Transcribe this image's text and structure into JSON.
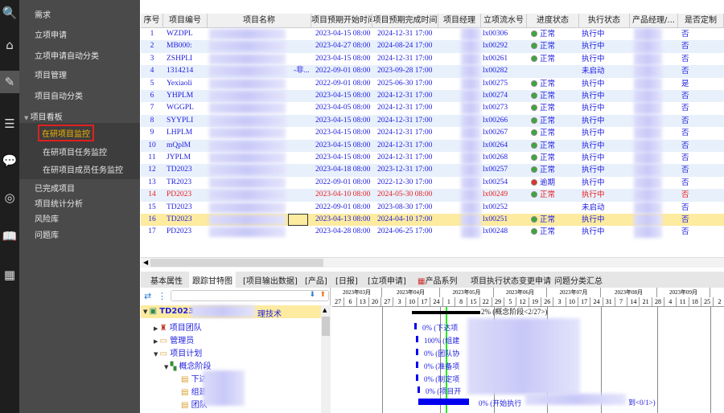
{
  "sidebar": {
    "items": [
      "需求",
      "立项申请",
      "立项申请自动分类",
      "项目管理",
      "项目自动分类",
      "项目看板",
      "在研项目监控",
      "在研项目任务监控",
      "在研项目成员任务监控",
      "已完成项目",
      "项目统计分析",
      "风险库",
      "问题库"
    ]
  },
  "table": {
    "headers": [
      "序号",
      "项目编号",
      "项目名称",
      "项目预期开始时间",
      "项目预期完成时间",
      "项目经理",
      "立项流水号",
      "进度状态",
      "执行状态",
      "产品经理/...",
      "是否定制"
    ],
    "rows": [
      [
        "1",
        "WZDPL",
        "2023-04-15 08:00",
        "2024-12-31 17:00",
        "lx00306",
        "正常",
        "执行中",
        "否"
      ],
      [
        "2",
        "MB000:",
        "2023-04-27 08:00",
        "2024-08-24 17:00",
        "lx00292",
        "正常",
        "执行中",
        "否"
      ],
      [
        "3",
        "ZSHPLI",
        "2023-04-15 08:00",
        "2024-12-31 17:00",
        "lx00261",
        "正常",
        "执行中",
        "否"
      ],
      [
        "4",
        "1314214",
        "2022-09-01 08:00",
        "2023-09-28 17:00",
        "lx00282",
        "",
        "未启动",
        "否"
      ],
      [
        "5",
        "Yexiaoli",
        "2022-09-01 08:00",
        "2025-06-30 17:00",
        "lx00275",
        "正常",
        "执行中",
        "是"
      ],
      [
        "6",
        "YHPLM",
        "2023-04-15 08:00",
        "2024-12-31 17:00",
        "lx00274",
        "正常",
        "执行中",
        "否"
      ],
      [
        "7",
        "WGGPL",
        "2023-04-05 08:00",
        "2024-12-31 17:00",
        "lx00273",
        "正常",
        "执行中",
        "否"
      ],
      [
        "8",
        "SYYPLI",
        "2023-04-15 08:00",
        "2024-12-31 17:00",
        "lx00266",
        "正常",
        "执行中",
        "否"
      ],
      [
        "9",
        "LHPLM",
        "2023-04-15 08:00",
        "2024-12-31 17:00",
        "lx00267",
        "正常",
        "执行中",
        "否"
      ],
      [
        "10",
        "mQplM",
        "2023-04-15 08:00",
        "2024-12-31 17:00",
        "lx00264",
        "正常",
        "执行中",
        "否"
      ],
      [
        "11",
        "JYPLM",
        "2023-04-15 08:00",
        "2024-12-31 17:00",
        "lx00268",
        "正常",
        "执行中",
        "否"
      ],
      [
        "12",
        "TD2023",
        "2023-04-18 08:00",
        "2023-12-31 17:00",
        "lx00257",
        "正常",
        "执行中",
        "否"
      ],
      [
        "13",
        "TR2023",
        "2022-09-01 08:00",
        "2022-12-30 17:00",
        "lx00254",
        "逾期",
        "执行中",
        "否"
      ],
      [
        "14",
        "PD2023",
        "2023-04-10 08:00",
        "2024-05-30 08:00",
        "lx00249",
        "正常",
        "执行中",
        "否"
      ],
      [
        "15",
        "TD2023",
        "2022-09-01 08:00",
        "2023-08-30 17:00",
        "lx00252",
        "",
        "未启动",
        "否"
      ],
      [
        "16",
        "TD2023",
        "2023-04-13 08:00",
        "2024-04-10 17:00",
        "lx00251",
        "正常",
        "执行中",
        "否"
      ],
      [
        "17",
        "PD2023",
        "2023-04-28 08:00",
        "2024-06-25 17:00",
        "lx00248",
        "正常",
        "执行中",
        "否"
      ]
    ],
    "row4_name_tail": "-非..."
  },
  "tabs": [
    "基本属性",
    "跟踪甘特图",
    "[项目输出数据]",
    "[产品]",
    "[日报]",
    "[立项申请]",
    "产品系列",
    "项目执行状态变更申请",
    "问题分类汇总"
  ],
  "tree": [
    "TD2023",
    "理技术",
    "项目团队",
    "管理员",
    "项目计划",
    "概念阶段",
    "下达",
    "组建",
    "团队"
  ],
  "gantt": {
    "months": [
      "2023年03月",
      "2023年04月",
      "2023年05月",
      "2023年06月",
      "2023年07月",
      "2023年08月",
      "2023年09月"
    ],
    "weeks": [
      "27",
      "6",
      "13",
      "20",
      "27",
      "3",
      "10",
      "17",
      "24",
      "1",
      "8",
      "15",
      "22",
      "29",
      "5",
      "12",
      "19",
      "26",
      "3",
      "10",
      "17",
      "24",
      "31",
      "7",
      "14",
      "21",
      "28",
      "4",
      "11",
      "18",
      "25",
      "2"
    ],
    "labels": [
      "2% (概念阶段<2/27>)",
      "0% (下达项",
      "100% (组建",
      "0% (团队协",
      "0% (准备项",
      "0% (制定项",
      "0% (项目开",
      "0% (开始执行",
      "到<0/1>)"
    ]
  }
}
